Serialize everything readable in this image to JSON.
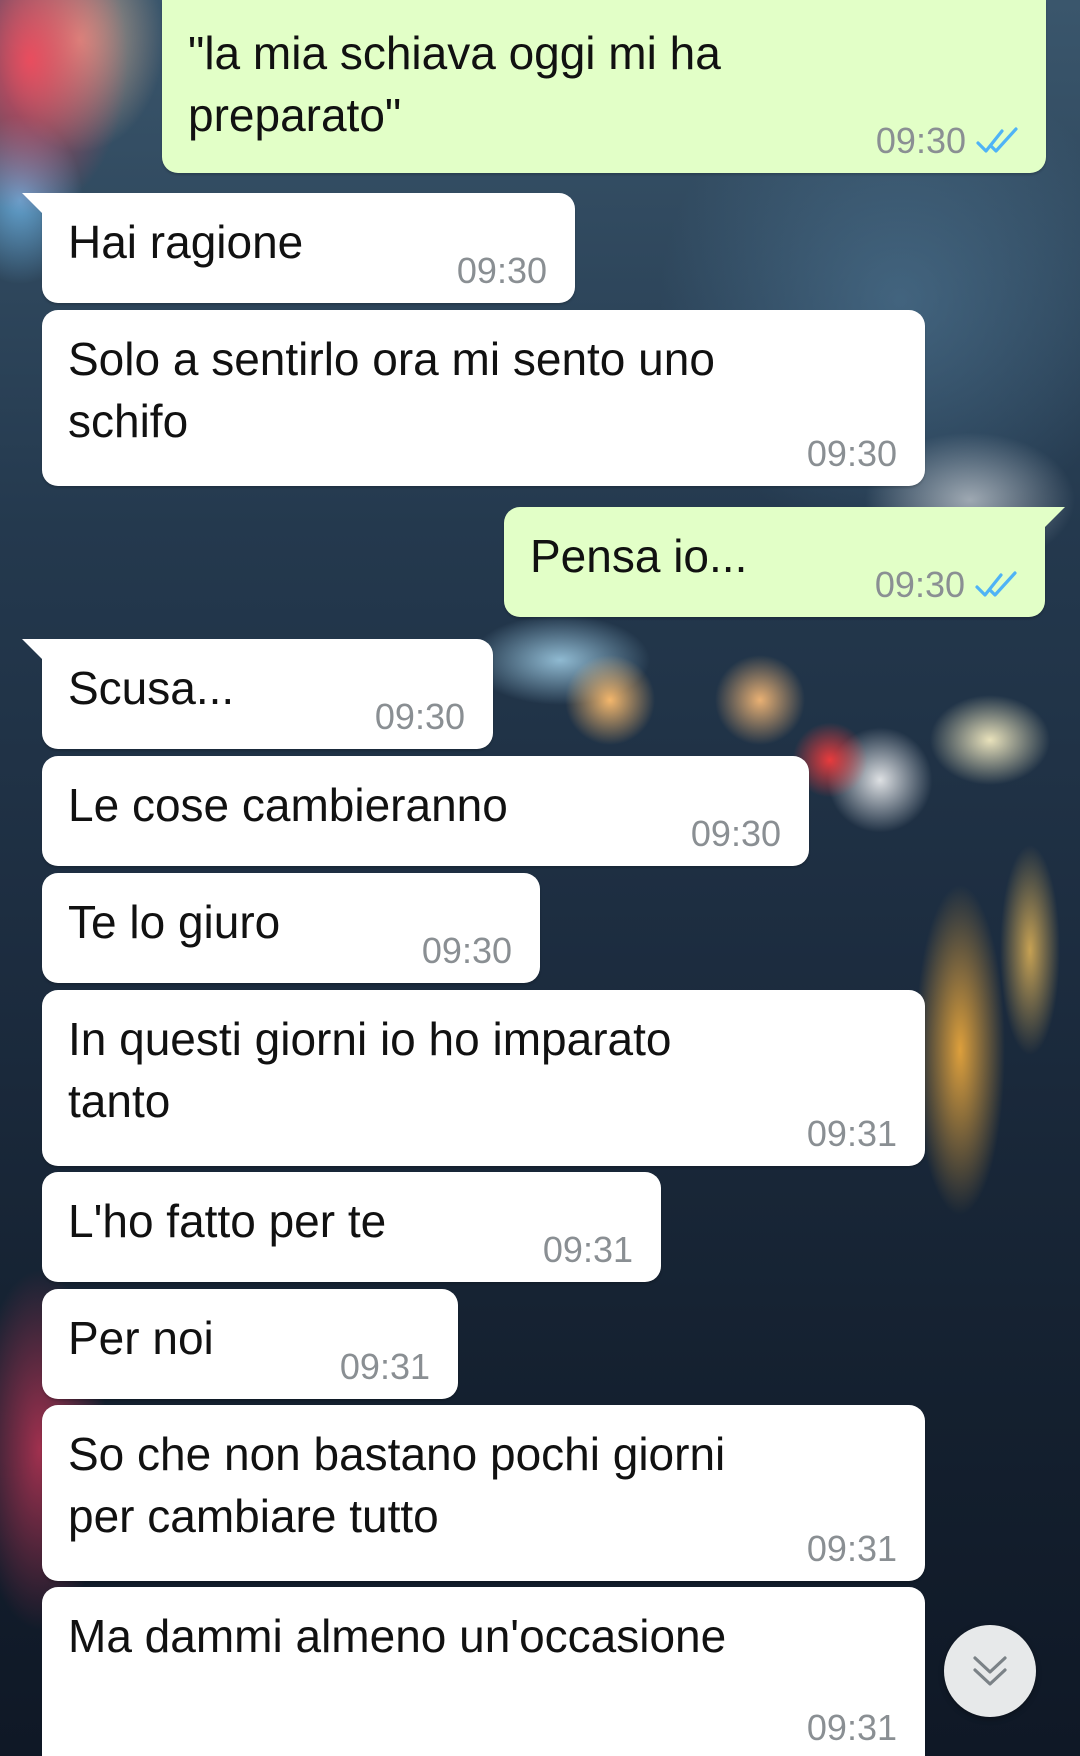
{
  "colors": {
    "incoming_bubble": "#ffffff",
    "outgoing_bubble": "#e2ffc7",
    "timestamp": "#8a8f93",
    "read_ticks": "#4fb3f6"
  },
  "messages": [
    {
      "direction": "out",
      "text": "\"la mia schiava oggi mi ha\npreparato\"",
      "time": "09:30",
      "status": "read"
    },
    {
      "direction": "in",
      "text": "Hai ragione",
      "time": "09:30"
    },
    {
      "direction": "in",
      "text": "Solo a sentirlo ora mi sento uno\nschifo",
      "time": "09:30"
    },
    {
      "direction": "out",
      "text": "Pensa io...",
      "time": "09:30",
      "status": "read"
    },
    {
      "direction": "in",
      "text": "Scusa...",
      "time": "09:30"
    },
    {
      "direction": "in",
      "text": "Le cose cambieranno",
      "time": "09:30"
    },
    {
      "direction": "in",
      "text": "Te lo giuro",
      "time": "09:30"
    },
    {
      "direction": "in",
      "text": "In questi giorni io ho imparato\ntanto",
      "time": "09:31"
    },
    {
      "direction": "in",
      "text": "L'ho fatto per te",
      "time": "09:31"
    },
    {
      "direction": "in",
      "text": "Per noi",
      "time": "09:31"
    },
    {
      "direction": "in",
      "text": "So che non bastano pochi giorni\nper cambiare tutto",
      "time": "09:31"
    },
    {
      "direction": "in",
      "text": "Ma dammi almeno un'occasione",
      "time": "09:31"
    }
  ],
  "scroll_button": {
    "icon": "double-chevron-down-icon"
  }
}
